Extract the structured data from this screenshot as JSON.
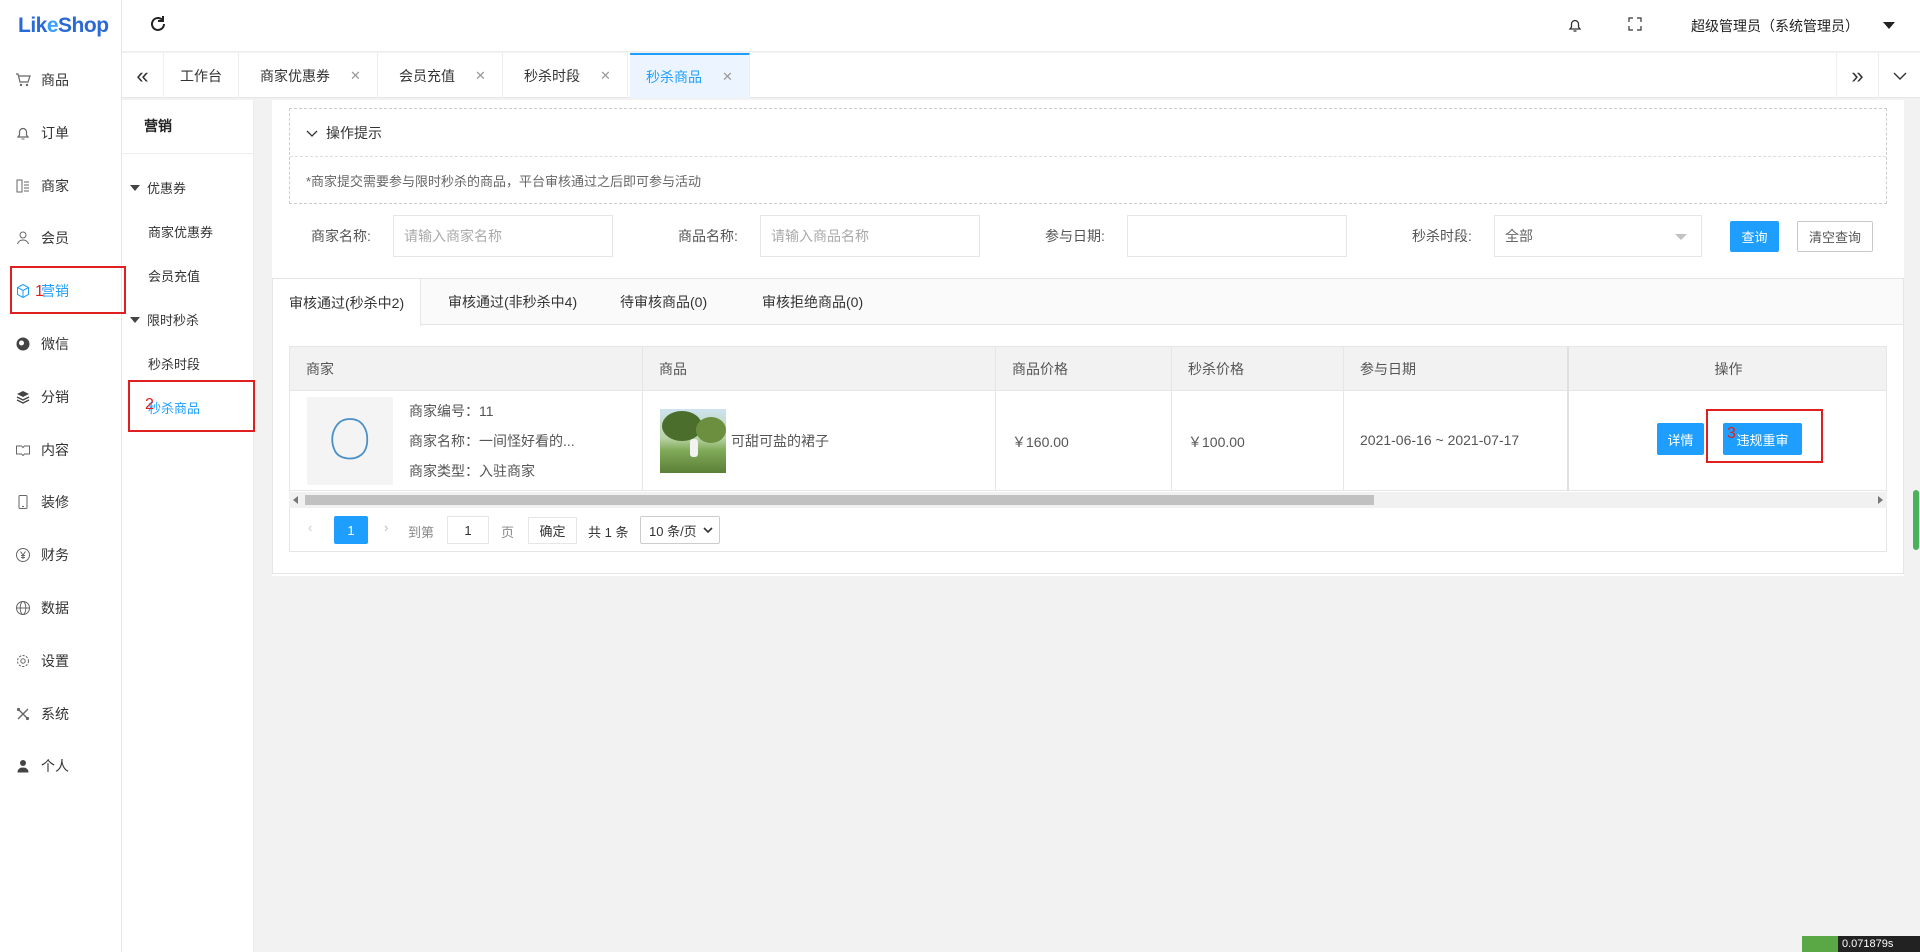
{
  "app": {
    "logo_prefix": "Lik",
    "logo_o": "e",
    "logo_suffix": "Shop"
  },
  "leftnav": {
    "items": [
      {
        "label": "商品",
        "icon": "cart-icon"
      },
      {
        "label": "订单",
        "icon": "bell-icon"
      },
      {
        "label": "商家",
        "icon": "shop-icon"
      },
      {
        "label": "会员",
        "icon": "user-icon"
      },
      {
        "label": "营销",
        "icon": "cube-icon"
      },
      {
        "label": "微信",
        "icon": "wechat-icon"
      },
      {
        "label": "分销",
        "icon": "layers-icon"
      },
      {
        "label": "内容",
        "icon": "book-icon"
      },
      {
        "label": "装修",
        "icon": "phone-icon"
      },
      {
        "label": "财务",
        "icon": "yen-icon"
      },
      {
        "label": "数据",
        "icon": "globe-icon"
      },
      {
        "label": "设置",
        "icon": "gear-icon"
      },
      {
        "label": "系统",
        "icon": "tools-icon"
      },
      {
        "label": "个人",
        "icon": "person-icon"
      }
    ],
    "active": "营销"
  },
  "subnav": {
    "title": "营销",
    "group1": "优惠券",
    "group1_items": [
      "商家优惠券",
      "会员充值"
    ],
    "group2": "限时秒杀",
    "group2_items": [
      "秒杀时段",
      "秒杀商品"
    ],
    "active": "秒杀商品"
  },
  "header": {
    "admin": "超级管理员（系统管理员）"
  },
  "tabs": [
    {
      "label": "工作台",
      "closable": false
    },
    {
      "label": "商家优惠券",
      "closable": true
    },
    {
      "label": "会员充值",
      "closable": true
    },
    {
      "label": "秒杀时段",
      "closable": true
    },
    {
      "label": "秒杀商品",
      "closable": true,
      "active": true
    }
  ],
  "tips": {
    "title": "操作提示",
    "body": "*商家提交需要参与限时秒杀的商品，平台审核通过之后即可参与活动"
  },
  "filters": {
    "shop_label": "商家名称:",
    "shop_placeholder": "请输入商家名称",
    "goods_label": "商品名称:",
    "goods_placeholder": "请输入商品名称",
    "date_label": "参与日期:",
    "date_value": "",
    "time_label": "秒杀时段:",
    "time_value": "全部",
    "query": "查询",
    "clear": "清空查询"
  },
  "review_tabs": [
    "审核通过(秒杀中2)",
    "审核通过(非秒杀中4)",
    "待审核商品(0)",
    "审核拒绝商品(0)"
  ],
  "table": {
    "columns": [
      "商家",
      "商品",
      "商品价格",
      "秒杀价格",
      "参与日期",
      "操作"
    ],
    "rows": [
      {
        "shop_no": "商家编号：11",
        "shop_name": "商家名称：一间怪好看的...",
        "shop_type": "商家类型：入驻商家",
        "goods_name": "可甜可盐的裙子",
        "price": "￥160.00",
        "seckill_price": "￥100.00",
        "date": "2021-06-16 ~ 2021-07-17",
        "detail": "详情",
        "recheck": "违规重审"
      }
    ]
  },
  "pager": {
    "current": "1",
    "goto": "到第",
    "page_value": "1",
    "page_unit": "页",
    "confirm": "确定",
    "total": "共 1 条",
    "per_page": "10 条/页"
  },
  "annotations": [
    "1",
    "2",
    "3"
  ],
  "corner_text": "0.071879s",
  "colors": {
    "accent": "#1e9fff",
    "annotation": "#e02020"
  }
}
